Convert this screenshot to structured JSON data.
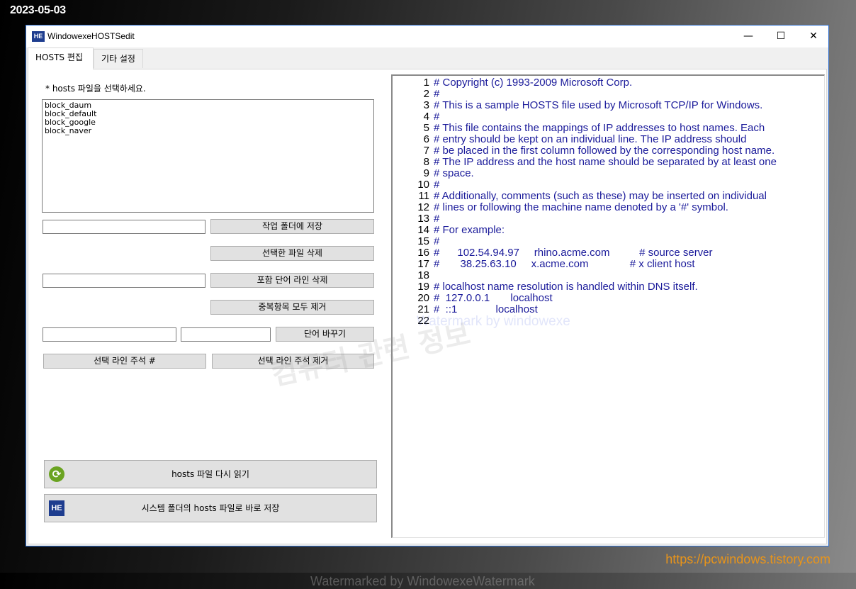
{
  "overlay": {
    "date": "2023-05-03",
    "url": "https://pcwindows.tistory.com"
  },
  "window": {
    "icon_text": "HE",
    "title": "WindowexeHOSTSedit",
    "controls": {
      "minimize": "—",
      "maximize": "☐",
      "close": "✕"
    }
  },
  "tabs": [
    {
      "label": "HOSTS 편집",
      "active": true
    },
    {
      "label": "기타 설정",
      "active": false
    }
  ],
  "left_panel": {
    "hint": "* hosts 파일을 선택하세요.",
    "files": [
      "block_daum",
      "block_default",
      "block_google",
      "block_naver"
    ],
    "save_input_value": "",
    "save_button": "작업 폴더에 저장",
    "delete_button": "선택한 파일 삭제",
    "contains_input_value": "",
    "delete_lines_button": "포함 단어 라인 삭제",
    "remove_dupes_button": "중복항목 모두 제거",
    "find_input_value": "",
    "replace_input_value": "",
    "replace_button": "단어 바꾸기",
    "comment_button": "선택 라인 주석 #",
    "uncomment_button": "선택 라인 주석 제거",
    "reload_button": "hosts 파일 다시 읽기",
    "reload_icon": "refresh-icon",
    "save_system_button": "시스템 폴더의 hosts 파일로 바로 저장",
    "save_system_icon_text": "HE"
  },
  "editor": {
    "lines": [
      {
        "n": "1",
        "text": "# Copyright (c) 1993-2009 Microsoft Corp."
      },
      {
        "n": "2",
        "text": "#"
      },
      {
        "n": "3",
        "text": "# This is a sample HOSTS file used by Microsoft TCP/IP for Windows."
      },
      {
        "n": "4",
        "text": "#"
      },
      {
        "n": "5",
        "text": "# This file contains the mappings of IP addresses to host names. Each"
      },
      {
        "n": "6",
        "text": "# entry should be kept on an individual line. The IP address should"
      },
      {
        "n": "7",
        "text": "# be placed in the first column followed by the corresponding host name."
      },
      {
        "n": "8",
        "text": "# The IP address and the host name should be separated by at least one"
      },
      {
        "n": "9",
        "text": "# space."
      },
      {
        "n": "10",
        "text": "#"
      },
      {
        "n": "11",
        "text": "# Additionally, comments (such as these) may be inserted on individual"
      },
      {
        "n": "12",
        "text": "# lines or following the machine name denoted by a '#' symbol."
      },
      {
        "n": "13",
        "text": "#"
      },
      {
        "n": "14",
        "text": "# For example:"
      },
      {
        "n": "15",
        "text": "#"
      },
      {
        "n": "16",
        "text": "#      102.54.94.97     rhino.acme.com          # source server"
      },
      {
        "n": "17",
        "text": "#       38.25.63.10     x.acme.com              # x client host"
      },
      {
        "n": "18",
        "text": ""
      },
      {
        "n": "19",
        "text": "# localhost name resolution is handled within DNS itself."
      },
      {
        "n": "20",
        "text": "#  127.0.0.1       localhost"
      },
      {
        "n": "21",
        "text": "#  ::1             localhost"
      },
      {
        "n": "22",
        "text": ""
      }
    ]
  },
  "watermarks": {
    "editor": "Watermark by windowexe",
    "bottom": "Watermarked by WindowexeWatermark",
    "korean": "컴퓨터 관련 정보"
  }
}
